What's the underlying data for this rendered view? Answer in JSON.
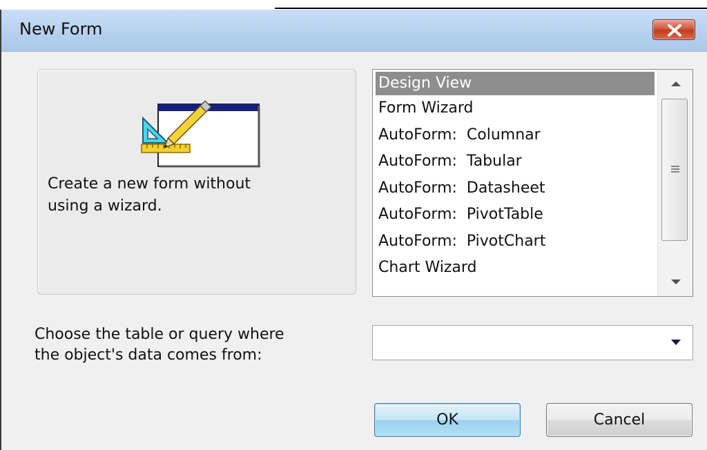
{
  "window": {
    "title": "New Form",
    "close_icon": "close-x-icon"
  },
  "preview": {
    "icon": "form-design-icon",
    "description": "Create a new form without\nusing a wizard."
  },
  "list": {
    "items": [
      {
        "label": "Design View",
        "selected": true
      },
      {
        "label": "Form Wizard",
        "selected": false
      },
      {
        "label": "AutoForm:  Columnar",
        "selected": false
      },
      {
        "label": "AutoForm:  Tabular",
        "selected": false
      },
      {
        "label": "AutoForm:  Datasheet",
        "selected": false
      },
      {
        "label": "AutoForm:  PivotTable",
        "selected": false
      },
      {
        "label": "AutoForm:  PivotChart",
        "selected": false
      },
      {
        "label": "Chart Wizard",
        "selected": false
      }
    ],
    "selection_color": "#8e8e8e"
  },
  "source": {
    "label": "Choose the table or query where\nthe object's data comes from:",
    "value": ""
  },
  "buttons": {
    "ok_label": "OK",
    "cancel_label": "Cancel"
  },
  "colors": {
    "titlebar": "#b6d1ef",
    "close_button": "#c23b1f",
    "dialog_background": "#f0f0f0",
    "ok_button": "#c4e5f6"
  }
}
